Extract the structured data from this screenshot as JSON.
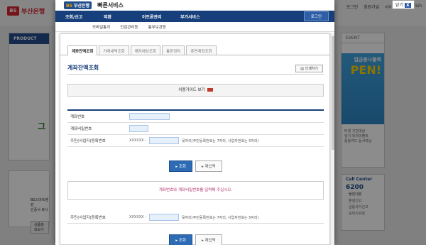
{
  "background": {
    "logo_mark": "BS",
    "logo_name": "부산은행",
    "util": [
      "로그인",
      "회원가입",
      "사이트맵",
      "English"
    ],
    "product_header": "PRODUCT",
    "product_big": "그",
    "small_text": [
      "BS스마트뱅킹",
      "인증서 복사"
    ],
    "small_button": "상품정보보기",
    "event_header": "EVENT",
    "event_banner_top": "업금융나들목",
    "event_banner_big": "PEN!",
    "event_text": [
      "터넷 기간대상",
      "잉기 유의이벤트",
      "용용카드 등사자님"
    ],
    "call_header": "Call Center",
    "call_number": "6200",
    "call_items": [
      "불편대출",
      "분실신고",
      "금융사기신고",
      "보이스피싱"
    ],
    "close_label": "닫기",
    "close_x": "X"
  },
  "popup": {
    "logo": "BS",
    "logo_text": "부산은행",
    "service_title": "빠른서비스",
    "gnb": [
      "조회/신고",
      "외환",
      "이트론관리",
      "부가서비스"
    ],
    "login": "로그인",
    "sub_menu": [
      "모바일통지",
      "인감관리등",
      "통부보관등"
    ]
  },
  "inner": {
    "tabs": [
      "계좌잔액조회",
      "거래내역조회",
      "해지예상조회",
      "통장정리",
      "휴면계좌조회"
    ],
    "title": "계좌잔액조회",
    "print": "인쇄하기",
    "guide": "이용가이드 보기",
    "fields": {
      "account_label": "계좌번호",
      "password_label": "계좌비밀번호",
      "resident_label": "주민(사업자)등록번호",
      "resident_prefix": "XXXXXX -",
      "resident_hint": "뒷자리(주민등록번호는 7자리, 사업자번호는 5자리)"
    },
    "query_button": "조회",
    "reset_button": "재입력",
    "notice": "계좌번호와 계좌비밀번호를 입력해 주십시오.",
    "repeat": {
      "resident_label": "주민(사업자)등록번호",
      "resident_prefix": "XXXXXX -",
      "resident_hint": "뒷자리(주민등록번호는 7자리, 사업자번호는 5자리)"
    }
  }
}
